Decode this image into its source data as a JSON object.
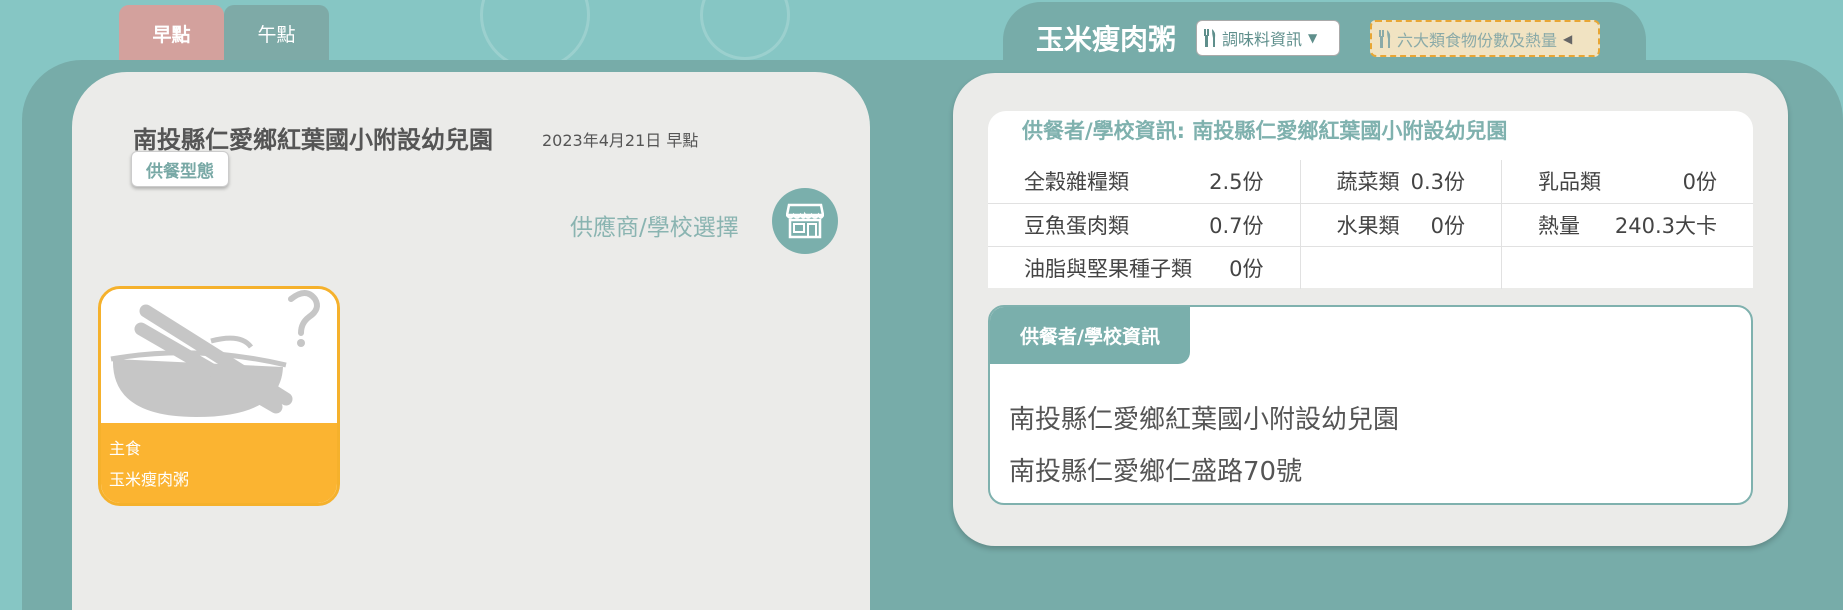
{
  "meal_tabs": [
    {
      "label": "早點",
      "active": true
    },
    {
      "label": "午點",
      "active": false
    }
  ],
  "dish": {
    "title": "玉米瘦肉粥",
    "seasoning_label": "調味料資訊",
    "food_group_label": "六大類食物份數及熱量"
  },
  "left": {
    "school_name": "南投縣仁愛鄉紅葉國小附設幼兒園",
    "date": "2023年4月21日 早點",
    "service_type_label": "供餐型態",
    "supplier_select_label": "供應商/學校選擇",
    "card": {
      "category": "主食",
      "name": "玉米瘦肉粥"
    }
  },
  "right": {
    "info_title": "供餐者/學校資訊: 南投縣仁愛鄉紅葉國小附設幼兒園",
    "nutrition": {
      "grains_label": "全穀雜糧類",
      "grains_value": "2.5份",
      "veg_label": "蔬菜類",
      "veg_value": "0.3份",
      "dairy_label": "乳品類",
      "dairy_value": "0份",
      "protein_label": "豆魚蛋肉類",
      "protein_value": "0.7份",
      "fruit_label": "水果類",
      "fruit_value": "0份",
      "calorie_label": "熱量",
      "calorie_value": "240.3大卡",
      "oil_label": "油脂與堅果種子類",
      "oil_value": "0份"
    },
    "supplier_tab_label": "供餐者/學校資訊",
    "supplier_name": "南投縣仁愛鄉紅葉國小附設幼兒園",
    "supplier_address": "南投縣仁愛鄉仁盛路70號"
  },
  "colors": {
    "background": "#86c6c4",
    "frame": "#77aca9",
    "tab_active": "#d3a19d",
    "card_accent": "#fbb431"
  }
}
